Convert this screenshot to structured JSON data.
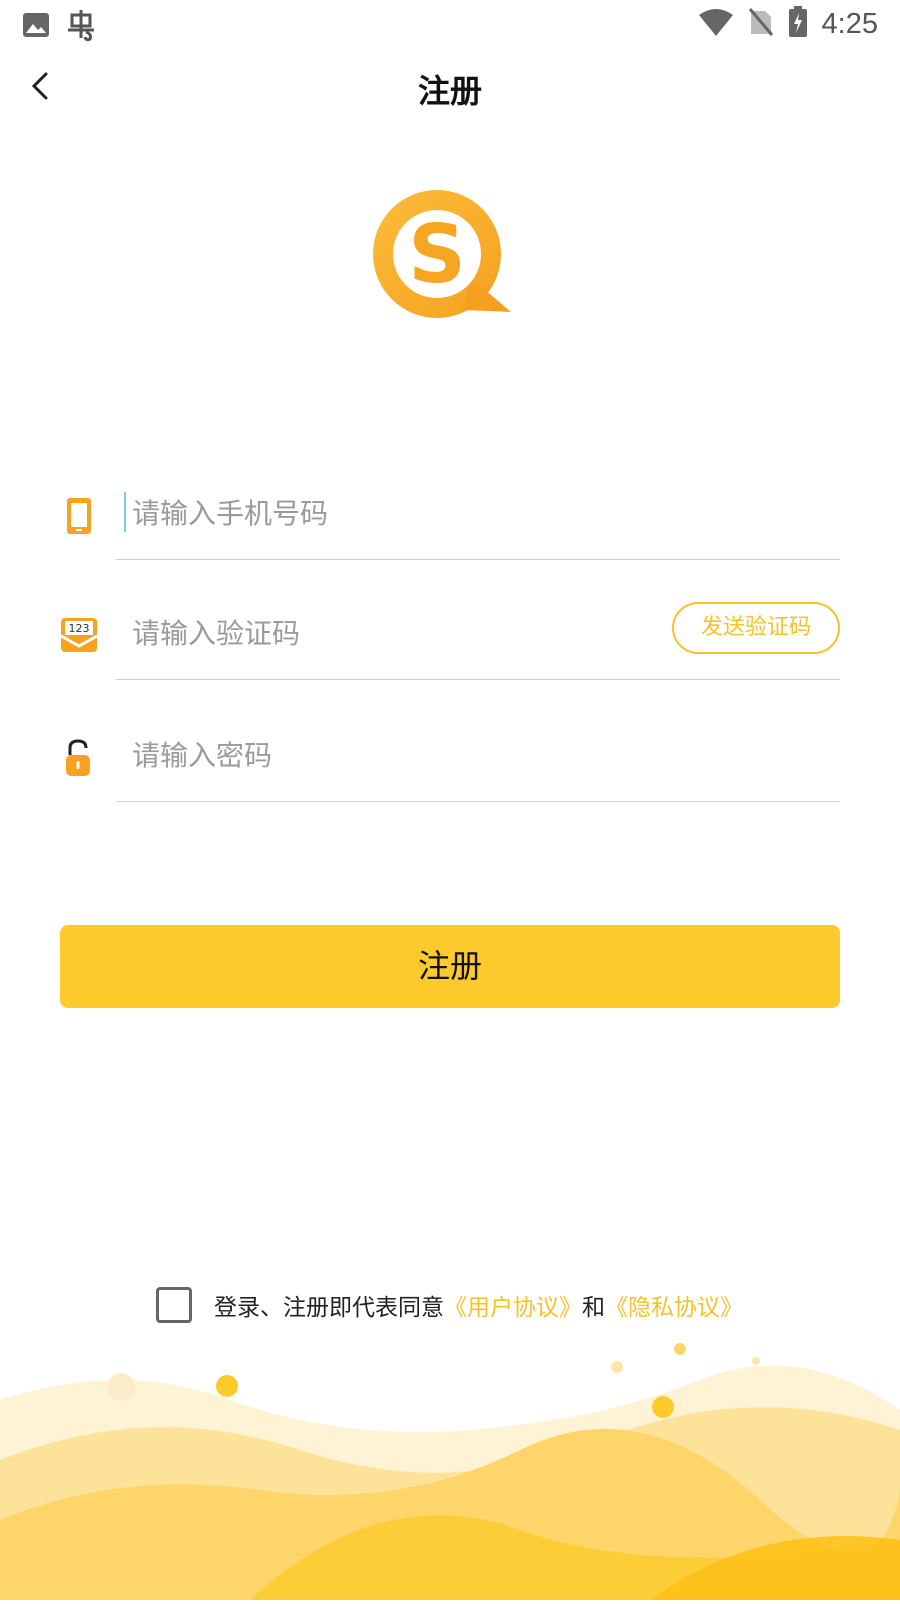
{
  "status_bar": {
    "time": "4:25",
    "left_icons": [
      "image-icon",
      "bug-icon"
    ],
    "right_icons": [
      "wifi-icon",
      "no-sim-icon",
      "battery-charging-icon"
    ]
  },
  "app_bar": {
    "title": "注册",
    "back_icon": "chevron-left-icon"
  },
  "form": {
    "phone": {
      "placeholder": "请输入手机号码",
      "value": "",
      "icon": "phone-icon"
    },
    "code": {
      "placeholder": "请输入验证码",
      "value": "",
      "icon": "message-123-icon",
      "send_label": "发送验证码"
    },
    "password": {
      "placeholder": "请输入密码",
      "value": "",
      "icon": "lock-icon"
    }
  },
  "register_button": "注册",
  "agreement": {
    "checked": false,
    "prefix": "登录、注册即代表同意",
    "user_agreement": "《用户协议》",
    "and": "和",
    "privacy_agreement": "《隐私协议》"
  },
  "colors": {
    "accent": "#fdca2c",
    "link": "#f6c22a",
    "logo": "#f6a622"
  }
}
